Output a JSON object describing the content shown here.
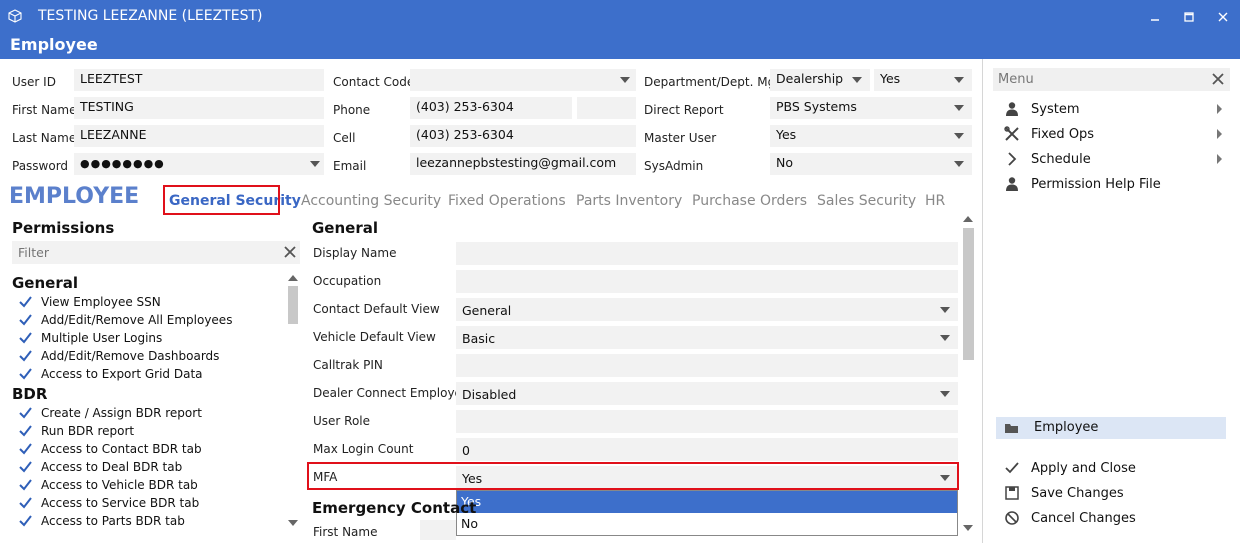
{
  "window": {
    "title": "TESTING LEEZANNE (LEEZTEST)"
  },
  "header": {
    "title": "Employee"
  },
  "user": {
    "user_id_label": "User ID",
    "user_id": "LEEZTEST",
    "first_name_label": "First Name",
    "first_name": "TESTING",
    "last_name_label": "Last Name",
    "last_name": "LEEZANNE",
    "password_label": "Password",
    "password": "●●●●●●●●"
  },
  "contact": {
    "contact_code_label": "Contact Code",
    "contact_code": "",
    "phone_label": "Phone",
    "phone": "(403) 253-6304",
    "cell_label": "Cell",
    "cell": "(403) 253-6304",
    "email_label": "Email",
    "email": "leezannepbstesting@gmail.com"
  },
  "dept": {
    "dept_label": "Department/Dept. Mgr",
    "dept_value": "Dealership",
    "mgr_value": "Yes",
    "direct_report_label": "Direct Report",
    "direct_report": "PBS Systems",
    "master_user_label": "Master User",
    "master_user": "Yes",
    "sysadmin_label": "SysAdmin",
    "sysadmin": "No"
  },
  "section_heading": "EMPLOYEE",
  "tabs": [
    {
      "label": "General Security"
    },
    {
      "label": "Accounting Security"
    },
    {
      "label": "Fixed Operations"
    },
    {
      "label": "Parts Inventory"
    },
    {
      "label": "Purchase Orders"
    },
    {
      "label": "Sales Security"
    },
    {
      "label": "HR"
    }
  ],
  "permissions": {
    "title": "Permissions",
    "filter_placeholder": "Filter",
    "groups": [
      {
        "name": "General",
        "items": [
          "View Employee SSN",
          "Add/Edit/Remove All Employees",
          "Multiple User Logins",
          "Add/Edit/Remove Dashboards",
          "Access to Export Grid Data"
        ]
      },
      {
        "name": "BDR",
        "items": [
          "Create / Assign BDR report",
          "Run BDR report",
          "Access to Contact BDR tab",
          "Access to Deal BDR tab",
          "Access to Vehicle BDR tab",
          "Access to Service BDR tab",
          "Access to Parts BDR tab"
        ]
      }
    ]
  },
  "general": {
    "title": "General",
    "fields": [
      {
        "label": "Display Name",
        "value": ""
      },
      {
        "label": "Occupation",
        "value": ""
      },
      {
        "label": "Contact Default View",
        "value": "General"
      },
      {
        "label": "Vehicle Default View",
        "value": "Basic"
      },
      {
        "label": "Calltrak PIN",
        "value": ""
      },
      {
        "label": "Dealer Connect Employee",
        "value": "Disabled"
      },
      {
        "label": "User Role",
        "value": ""
      },
      {
        "label": "Max Login Count",
        "value": "0"
      },
      {
        "label": "MFA",
        "value": "Yes"
      }
    ],
    "mfa_options": [
      "Yes",
      "No"
    ],
    "emergency_title": "Emergency Contact",
    "emergency_first_name_label": "First Name"
  },
  "menu": {
    "title": "Menu",
    "items": [
      {
        "label": "System",
        "icon": "users-icon"
      },
      {
        "label": "Fixed Ops",
        "icon": "tools-icon"
      },
      {
        "label": "Schedule",
        "icon": "chevron-right-icon"
      },
      {
        "label": "Permission Help File",
        "icon": "user-help-icon"
      }
    ],
    "selected_item": "Employee",
    "actions": [
      {
        "label": "Apply and Close",
        "icon": "check-icon"
      },
      {
        "label": "Save Changes",
        "icon": "save-icon"
      },
      {
        "label": "Cancel Changes",
        "icon": "cancel-icon"
      }
    ]
  },
  "colors": {
    "accent": "#3d6fcb",
    "highlight": "#e0101a",
    "selected": "#dce6f5"
  }
}
